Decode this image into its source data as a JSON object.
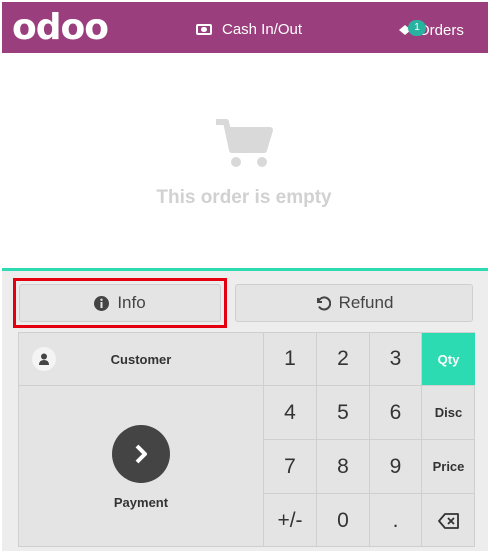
{
  "header": {
    "logo": "odoo",
    "cash_label": "Cash In/Out",
    "orders_label": "Orders",
    "orders_badge": "1",
    "background_color": "#9b3e7d"
  },
  "order": {
    "empty_text": "This order is empty"
  },
  "controls": {
    "info_label": "Info",
    "refund_label": "Refund",
    "accent_color": "#2cdbb1",
    "highlight_color": "#e3000f"
  },
  "pad": {
    "customer_label": "Customer",
    "payment_label": "Payment",
    "keys": {
      "k1": "1",
      "k2": "2",
      "k3": "3",
      "k4": "4",
      "k5": "5",
      "k6": "6",
      "k7": "7",
      "k8": "8",
      "k9": "9",
      "plusminus": "+/-",
      "k0": "0",
      "dot": "."
    },
    "modes": {
      "qty": "Qty",
      "disc": "Disc",
      "price": "Price"
    },
    "active_mode": "Qty"
  },
  "icons": [
    "cash-icon",
    "ticket-icon",
    "cart-icon",
    "info-icon",
    "undo-icon",
    "user-icon",
    "chevron-right-icon",
    "backspace-icon"
  ]
}
